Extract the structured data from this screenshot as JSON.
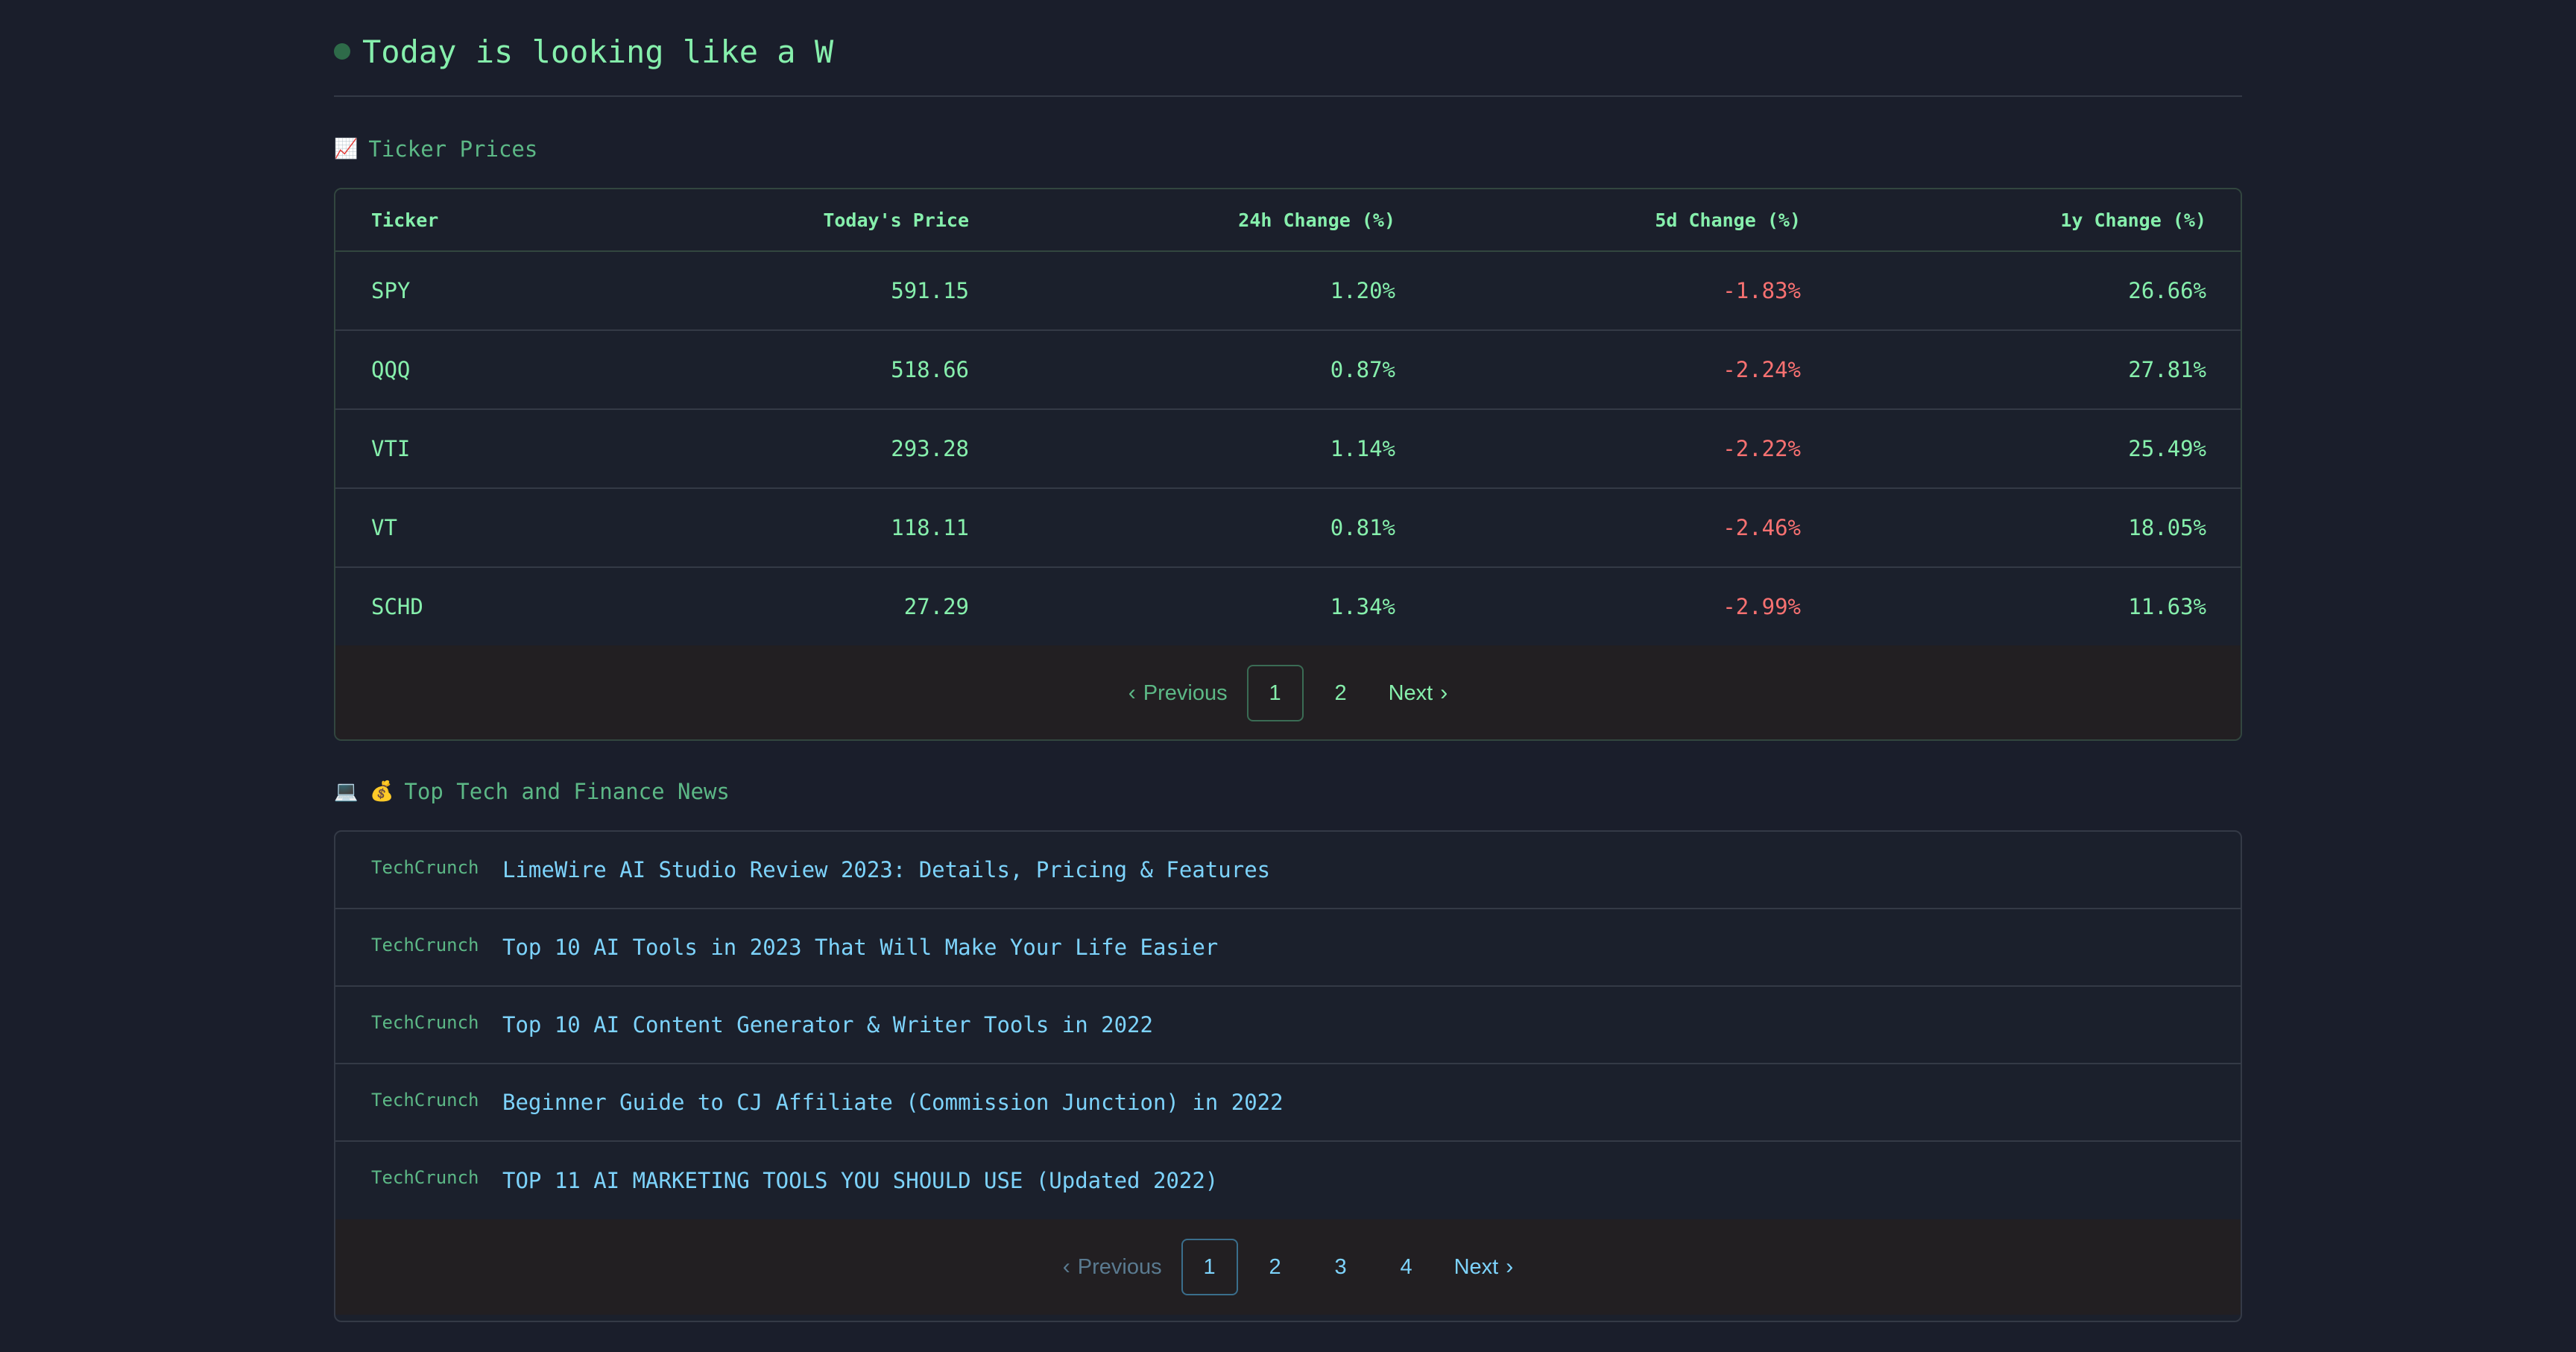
{
  "header": {
    "title": "Today is looking like a W"
  },
  "ticker_section": {
    "emoji": "📈",
    "title": "Ticker Prices",
    "columns": [
      "Ticker",
      "Today's Price",
      "24h Change (%)",
      "5d Change (%)",
      "1y Change (%)"
    ],
    "rows": [
      {
        "ticker": "SPY",
        "price": "591.15",
        "ch24h": "1.20%",
        "ch5d": "-1.83%",
        "ch1y": "26.66%"
      },
      {
        "ticker": "QQQ",
        "price": "518.66",
        "ch24h": "0.87%",
        "ch5d": "-2.24%",
        "ch1y": "27.81%"
      },
      {
        "ticker": "VTI",
        "price": "293.28",
        "ch24h": "1.14%",
        "ch5d": "-2.22%",
        "ch1y": "25.49%"
      },
      {
        "ticker": "VT",
        "price": "118.11",
        "ch24h": "0.81%",
        "ch5d": "-2.46%",
        "ch1y": "18.05%"
      },
      {
        "ticker": "SCHD",
        "price": "27.29",
        "ch24h": "1.34%",
        "ch5d": "-2.99%",
        "ch1y": "11.63%"
      }
    ],
    "pagination": {
      "previous": "Previous",
      "next": "Next",
      "pages": [
        "1",
        "2"
      ],
      "current": "1"
    }
  },
  "news_section": {
    "emoji": "💻 💰",
    "title": "Top Tech and Finance News",
    "items": [
      {
        "source": "TechCrunch",
        "title": "LimeWire AI Studio Review 2023: Details, Pricing & Features"
      },
      {
        "source": "TechCrunch",
        "title": "Top 10 AI Tools in 2023 That Will Make Your Life Easier"
      },
      {
        "source": "TechCrunch",
        "title": "Top 10 AI Content Generator & Writer Tools in 2022"
      },
      {
        "source": "TechCrunch",
        "title": "Beginner Guide to CJ Affiliate (Commission Junction) in 2022"
      },
      {
        "source": "TechCrunch",
        "title": "TOP 11 AI MARKETING TOOLS YOU SHOULD USE (Updated 2022)"
      }
    ],
    "pagination": {
      "previous": "Previous",
      "next": "Next",
      "pages": [
        "1",
        "2",
        "3",
        "4"
      ],
      "current": "1"
    }
  },
  "colors": {
    "background": "#1a1e2b",
    "positive": "#86efac",
    "negative": "#f87171",
    "news_link": "#7dd3fc"
  }
}
